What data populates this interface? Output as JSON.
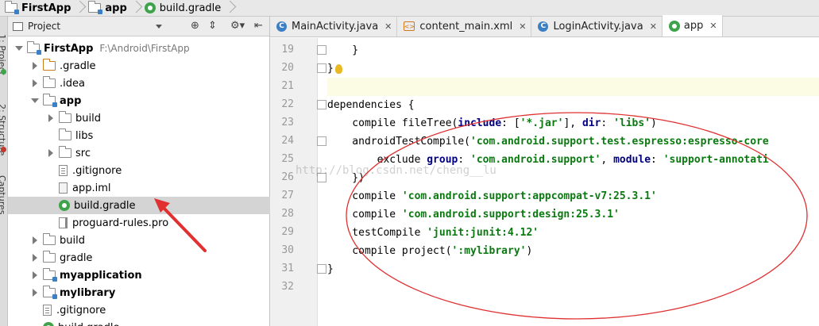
{
  "breadcrumb": {
    "items": [
      "FirstApp",
      "app",
      "build.gradle"
    ]
  },
  "left_strip": {
    "labels": [
      "1: Project",
      "2: Structure",
      "Captures"
    ]
  },
  "project_panel": {
    "view_mode": "Project",
    "tree": [
      {
        "label": "FirstApp",
        "path": "F:\\Android\\FirstApp",
        "bold": true,
        "icon": "module-folder-icon",
        "expanded": true
      },
      {
        "label": ".gradle",
        "icon": "folder-icon"
      },
      {
        "label": ".idea",
        "icon": "folder-icon"
      },
      {
        "label": "app",
        "bold": true,
        "icon": "module-folder-icon",
        "expanded": true
      },
      {
        "label": "build",
        "icon": "folder-icon"
      },
      {
        "label": "libs",
        "icon": "folder-icon"
      },
      {
        "label": "src",
        "icon": "folder-icon"
      },
      {
        "label": ".gitignore",
        "icon": "file-icon"
      },
      {
        "label": "app.iml",
        "icon": "iml-file-icon"
      },
      {
        "label": "build.gradle",
        "icon": "gradle-icon",
        "selected": true
      },
      {
        "label": "proguard-rules.pro",
        "icon": "pro-file-icon"
      },
      {
        "label": "build",
        "icon": "folder-icon"
      },
      {
        "label": "gradle",
        "icon": "folder-icon"
      },
      {
        "label": "myapplication",
        "bold": true,
        "icon": "module-folder-icon"
      },
      {
        "label": "mylibrary",
        "bold": true,
        "icon": "module-folder-icon"
      },
      {
        "label": ".gitignore",
        "icon": "file-icon"
      },
      {
        "label": "build.gradle",
        "icon": "gradle-icon"
      }
    ]
  },
  "tabs": [
    {
      "label": "MainActivity.java",
      "icon": "c"
    },
    {
      "label": "content_main.xml",
      "icon": "xml"
    },
    {
      "label": "LoginActivity.java",
      "icon": "c"
    },
    {
      "label": "app",
      "icon": "gradle",
      "active": true
    }
  ],
  "editor": {
    "lines": [
      {
        "n": "19",
        "text": "    }"
      },
      {
        "n": "20",
        "text": "}"
      },
      {
        "n": "21",
        "text": ""
      },
      {
        "n": "22",
        "text": "dependencies {"
      },
      {
        "n": "23",
        "text": "    compile fileTree(include: ['*.jar'], dir: 'libs')"
      },
      {
        "n": "24",
        "text": "    androidTestCompile('com.android.support.test.espresso:espresso-core"
      },
      {
        "n": "25",
        "text": "        exclude group: 'com.android.support', module: 'support-annotati"
      },
      {
        "n": "26",
        "text": "    })"
      },
      {
        "n": "27",
        "text": "    compile 'com.android.support:appcompat-v7:25.3.1'"
      },
      {
        "n": "28",
        "text": "    compile 'com.android.support:design:25.3.1'"
      },
      {
        "n": "29",
        "text": "    testCompile 'junit:junit:4.12'"
      },
      {
        "n": "30",
        "text": "    compile project(':mylibrary')"
      },
      {
        "n": "31",
        "text": "}"
      },
      {
        "n": "32",
        "text": ""
      }
    ],
    "watermark": "http://blog.csdn.net/cheng__lu"
  },
  "colors": {
    "string": "#0a7a10",
    "keyword": "#000080",
    "annotation": "#e03030",
    "current_line": "#fcfbe3"
  }
}
